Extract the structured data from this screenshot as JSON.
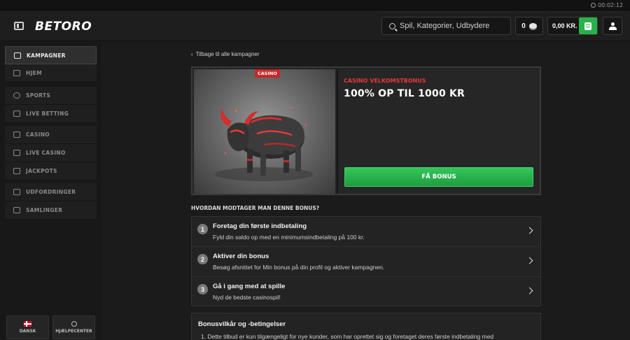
{
  "topbar": {
    "clock": "00:02:12"
  },
  "header": {
    "logo": "BETORO",
    "search_placeholder": "Spil, Kategorier, Udbydere",
    "coins": "0",
    "balance": "0,00 KR."
  },
  "sidebar": {
    "items": [
      {
        "label": "KAMPAGNER",
        "icon": "gift-icon"
      },
      {
        "label": "HJEM",
        "icon": "home-icon"
      },
      {
        "label": "SPORTS",
        "icon": "soccer-ball-icon"
      },
      {
        "label": "LIVE BETTING",
        "icon": "monitor-icon"
      },
      {
        "label": "CASINO",
        "icon": "slot-machine-icon"
      },
      {
        "label": "LIVE CASINO",
        "icon": "card-table-icon"
      },
      {
        "label": "JACKPOTS",
        "icon": "diamond-icon"
      },
      {
        "label": "UDFORDRINGER",
        "icon": "trophy-icon"
      },
      {
        "label": "SAMLINGER",
        "icon": "grid-icon"
      }
    ],
    "language_label": "DANSK",
    "help_label": "HJÆLPECENTER"
  },
  "main": {
    "back_link": "Tilbage til alle kampagner",
    "promo": {
      "category": "CASINO",
      "subtitle": "CASINO VELKOMSTBONUS",
      "title": "100% OP TIL  1000 KR",
      "button": "FÅ BONUS"
    },
    "howto_title": "HVORDAN MODTAGER MAN DENNE BONUS?",
    "steps": [
      {
        "num": "1",
        "title": "Foretag din første indbetaling",
        "desc": "Fyld din saldo op med en minimumsindbetaling på 100 kr."
      },
      {
        "num": "2",
        "title": "Aktiver din bonus",
        "desc": "Besøg afsnittet for Min bonus på din profil og aktiver kampagnen."
      },
      {
        "num": "3",
        "title": "Gå i gang med at spille",
        "desc": "Nyd de bedste casinospil!"
      }
    ],
    "terms": {
      "title": "Bonusvilkår og -betingelser",
      "item1": "1.  Dette tilbud er kun tilgængeligt for nye kunder, som har oprettet sig og foretaget deres første indbetaling med"
    }
  },
  "colors": {
    "accent_green": "#27b24a",
    "accent_red": "#e53935",
    "background": "#1b1b1b"
  }
}
